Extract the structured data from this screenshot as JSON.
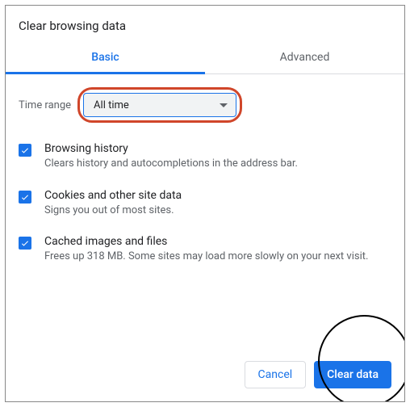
{
  "dialog": {
    "title": "Clear browsing data"
  },
  "tabs": {
    "basic": "Basic",
    "advanced": "Advanced"
  },
  "timeRange": {
    "label": "Time range",
    "value": "All time"
  },
  "options": {
    "history": {
      "title": "Browsing history",
      "desc": "Clears history and autocompletions in the address bar."
    },
    "cookies": {
      "title": "Cookies and other site data",
      "desc": "Signs you out of most sites."
    },
    "cache": {
      "title": "Cached images and files",
      "desc": "Frees up 318 MB. Some sites may load more slowly on your next visit."
    }
  },
  "buttons": {
    "cancel": "Cancel",
    "clear": "Clear data"
  }
}
